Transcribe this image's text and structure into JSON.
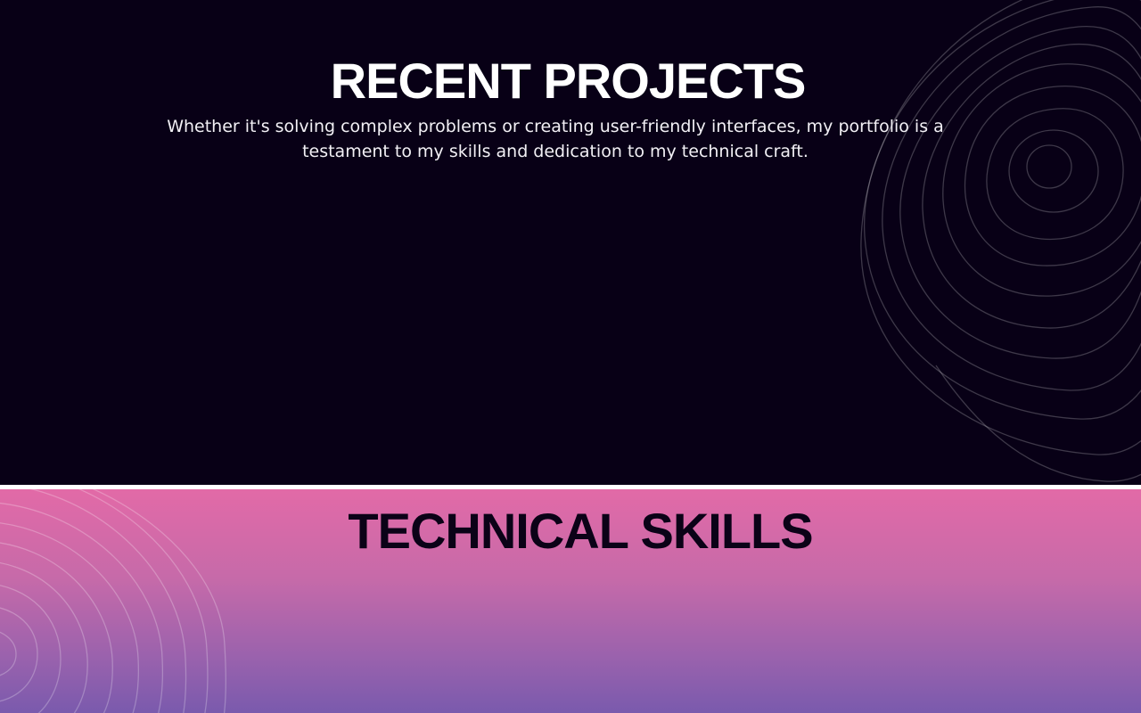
{
  "projects": {
    "title": "RECENT PROJECTS",
    "description": "Whether it's solving complex problems or creating user-friendly interfaces, my portfolio is a testament to my skills and dedication to my technical craft.",
    "background_color": "#080016",
    "text_color": "#ffffff",
    "decoration": "topographic-lines"
  },
  "skills": {
    "title": "TECHNICAL SKILLS",
    "gradient_top": "#e26aa7",
    "gradient_bottom": "#7a5aad",
    "text_color": "#0b0217",
    "decoration": "topographic-lines"
  }
}
